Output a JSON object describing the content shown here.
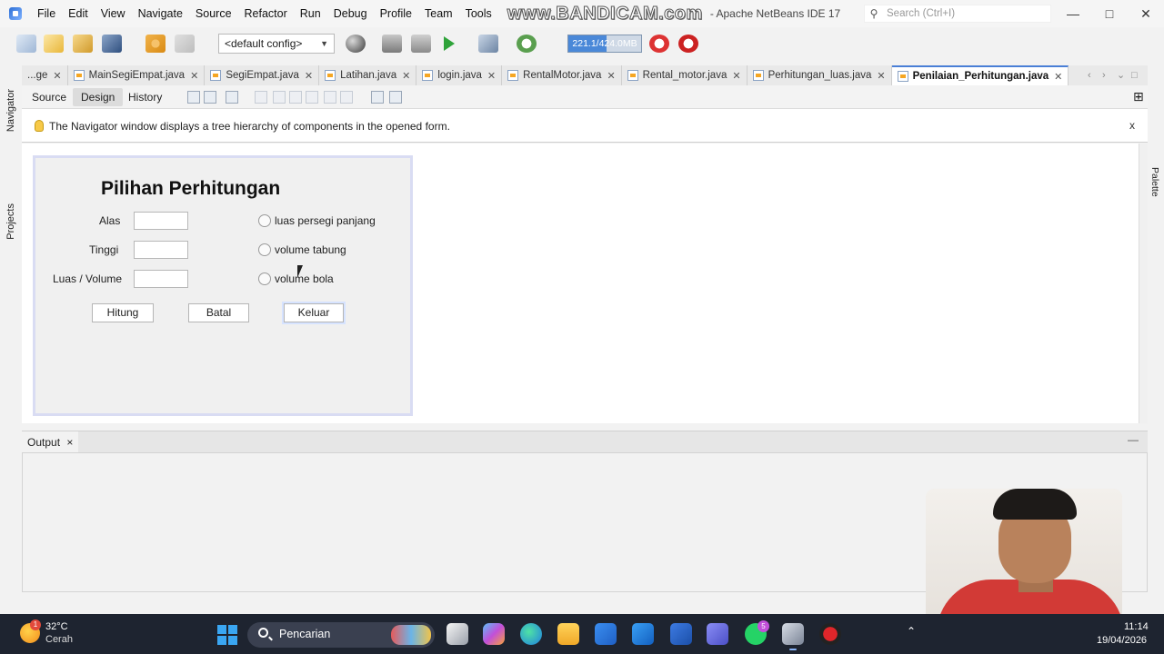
{
  "menubar": {
    "items": [
      "File",
      "Edit",
      "View",
      "Navigate",
      "Source",
      "Refactor",
      "Run",
      "Debug",
      "Profile",
      "Team",
      "Tools"
    ],
    "watermark": "www.BANDICAM.com",
    "title_suffix": "- Apache NetBeans IDE 17",
    "search_placeholder": "Search (Ctrl+I)"
  },
  "toolbar": {
    "config": "<default config>",
    "memory": "221.1/424.0MB",
    "memory_fraction": 0.52
  },
  "sidebars": {
    "left": [
      "Navigator",
      "Projects"
    ],
    "right": [
      "Palette"
    ]
  },
  "editor_tabs": [
    {
      "label": "...ge",
      "active": false
    },
    {
      "label": "MainSegiEmpat.java",
      "active": false
    },
    {
      "label": "SegiEmpat.java",
      "active": false
    },
    {
      "label": "Latihan.java",
      "active": false
    },
    {
      "label": "login.java",
      "active": false
    },
    {
      "label": "RentalMotor.java",
      "active": false
    },
    {
      "label": "Rental_motor.java",
      "active": false
    },
    {
      "label": "Perhitungan_luas.java",
      "active": false
    },
    {
      "label": "Penilaian_Perhitungan.java",
      "active": true
    }
  ],
  "design_tabs": [
    "Source",
    "Design",
    "History"
  ],
  "info": {
    "message": "The Navigator window displays a tree hierarchy of components in the opened form.",
    "close": "x"
  },
  "form": {
    "title": "Pilihan Perhitungan",
    "labels": [
      "Alas",
      "Tinggi",
      "Luas / Volume"
    ],
    "radios": [
      "luas persegi panjang",
      "volume tabung",
      "volume bola"
    ],
    "buttons": [
      "Hitung",
      "Batal",
      "Keluar"
    ]
  },
  "output": {
    "tab": "Output",
    "close": "×",
    "minimize": "—"
  },
  "taskbar": {
    "weather_badge": "1",
    "temperature": "32°C",
    "condition": "Cerah",
    "search": "Pencarian",
    "store_badge": "5",
    "time": "11:14",
    "date": "19/04/2026"
  },
  "colors": {
    "accent": "#4a7fd6",
    "taskbar": "#1e2430",
    "form_border": "#d9dcf3"
  },
  "icons": [
    "netbeans-logo-icon",
    "new-file-icon",
    "new-project-icon",
    "open-project-icon",
    "save-all-icon",
    "undo-icon",
    "redo-icon",
    "globe-icon",
    "clean-build-icon",
    "build-icon",
    "run-icon",
    "debug-icon",
    "profile-icon",
    "gc-icon",
    "profiler-icon",
    "bulb-icon",
    "windows-start-icon"
  ]
}
